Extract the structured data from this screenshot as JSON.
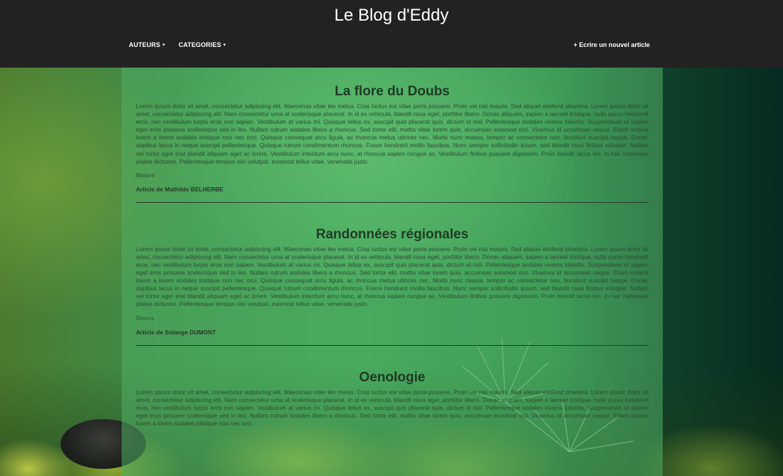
{
  "site": {
    "title": "Le Blog d'Eddy"
  },
  "nav": {
    "items": [
      {
        "label": "AUTEURS",
        "caret": "▾"
      },
      {
        "label": "CATEGORIES",
        "caret": "▾"
      }
    ],
    "new_article": "+ Ecrire un nouvel article"
  },
  "articles": [
    {
      "title": "La flore du Doubs",
      "body": "Lorem ipsum dolor sit amet, consectetur adipiscing elit. Maecenas vitae leo metus. Cras luctus est vitae porta posuere. Proin vel nisi mauris. Sed aliquet eleifend pharetra. Lorem ipsum dolor sit amet, consectetur adipiscing elit. Nam consectetur urna at scelerisque placerat. In id ex vehicula, blandit risus eget, porttitor libero. Donec aliquam, sapien a laoreet tristique, nulla purus hendrerit eros, nec vestibulum turpis eros non sapien. Vestibulum at varius mi. Quisque tellus ex, suscipit quis placerat quis, dictum id nisl. Pellentesque sodales viverra lobortis. Suspendisse ut sapien eget eros posuere scelerisque sed in leo. Nullam rutrum sodales libero a rhoncus. Sed tortor elit, mattis vitae lorem quis, accumsan euismod orci. Vivamus id accumsan neque. Etiam viverra lorem a lorem sodales tristique non nec orci. Quisque consequat arcu ligula, ac rhoncus metus ultrices nec. Morbi nunc massa, tempor ac consectetur non, tincidunt suscipit neque. Donec dapibus lacus in neque suscipit pellentesque. Quisque rutrum condimentum rhoncus. Fusce hendrerit mollis faucibus. Nunc semper sollicitudin ipsum, sed blandit risus finibus volutpat. Nullam vel tortor eget erat blandit aliquam eget ac lorem. Vestibulum interdum arcu nunc, at rhoncus sapien congue ac. Vestibulum finibus posuere dignissim. Proin blandit lacus leo. In hac habitasse platea dictumst. Pellentesque tempus nisi volutpat, euismod tellus vitae, venenatis justo.",
      "category": "Nature",
      "author": "Article de Mathilde BELHERBE"
    },
    {
      "title": "Randonnées régionales",
      "body": "Lorem ipsum dolor sit amet, consectetur adipiscing elit. Maecenas vitae leo metus. Cras luctus est vitae porta posuere. Proin vel nisi mauris. Sed aliquet eleifend pharetra. Lorem ipsum dolor sit amet, consectetur adipiscing elit. Nam consectetur urna at scelerisque placerat. In id ex vehicula, blandit risus eget, porttitor libero. Donec aliquam, sapien a laoreet tristique, nulla purus hendrerit eros, nec vestibulum turpis eros non sapien. Vestibulum at varius mi. Quisque tellus ex, suscipit quis placerat quis, dictum id nisl. Pellentesque sodales viverra lobortis. Suspendisse ut sapien eget eros posuere scelerisque sed in leo. Nullam rutrum sodales libero a rhoncus. Sed tortor elit, mattis vitae lorem quis, accumsan euismod orci. Vivamus id accumsan neque. Etiam viverra lorem a lorem sodales tristique non nec orci. Quisque consequat arcu ligula, ac rhoncus metus ultrices nec. Morbi nunc massa, tempor ac consectetur non, tincidunt suscipit neque. Donec dapibus lacus in neque suscipit pellentesque. Quisque rutrum condimentum rhoncus. Fusce hendrerit mollis faucibus. Nunc semper sollicitudin ipsum, sed blandit risus finibus volutpat. Nullam vel tortor eget erat blandit aliquam eget ac lorem. Vestibulum interdum arcu nunc, at rhoncus sapien congue ac. Vestibulum finibus posuere dignissim. Proin blandit lacus leo. In hac habitasse platea dictumst. Pellentesque tempus nisi volutpat, euismod tellus vitae, venenatis justo.",
      "category": "Divers",
      "author": "Article de Solange DUMONT"
    },
    {
      "title": "Oenologie",
      "body": "Lorem ipsum dolor sit amet, consectetur adipiscing elit. Maecenas vitae leo metus. Cras luctus est vitae porta posuere. Proin vel nisi mauris. Sed aliquet eleifend pharetra. Lorem ipsum dolor sit amet, consectetur adipiscing elit. Nam consectetur urna at scelerisque placerat. In id ex vehicula, blandit risus eget, porttitor libero. Donec aliquam, sapien a laoreet tristique, nulla purus hendrerit eros, nec vestibulum turpis eros non sapien. Vestibulum at varius mi. Quisque tellus ex, suscipit quis placerat quis, dictum id nisl. Pellentesque sodales viverra lobortis. Suspendisse ut sapien eget eros posuere scelerisque sed in leo. Nullam rutrum sodales libero a rhoncus. Sed tortor elit, mattis vitae lorem quis, accumsan euismod orci. Vivamus id accumsan neque. Etiam viverra lorem a lorem sodales tristique non nec orci.",
      "category": "",
      "author": ""
    }
  ],
  "colors": {
    "header_bg": "#222222",
    "header_text": "#ffffff",
    "panel_bg": "rgba(80,175,100,0.55)",
    "title_text": "#1f3b24",
    "category_text": "#2f6a38"
  },
  "icons": {
    "dropdown": "caret-down-icon"
  }
}
